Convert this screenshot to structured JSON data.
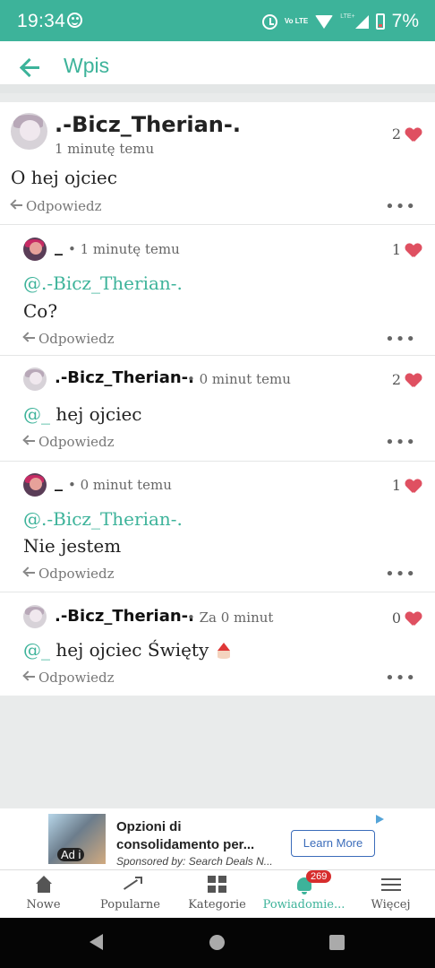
{
  "status": {
    "time": "19:34",
    "battery": "7%",
    "volte": "Vo LTE",
    "lte": "LTE+"
  },
  "app_bar": {
    "title": "Wpis"
  },
  "post": {
    "author": ".-Bicz_Therian-.",
    "time": "1 minutę temu",
    "likes": "2",
    "text": "O hej ojciec",
    "reply": "Odpowiedz"
  },
  "comments": [
    {
      "author": "_",
      "time": "• 1 minutę temu",
      "likes": "1",
      "mention": "@.-Bicz_Therian-.",
      "text": "Co?",
      "reply": "Odpowiedz"
    },
    {
      "author": ".-Bicz_Therian-.",
      "time": "• 0 minut temu",
      "likes": "2",
      "mention": "@_",
      "text": "hej ojciec",
      "reply": "Odpowiedz"
    },
    {
      "author": "_",
      "time": "• 0 minut temu",
      "likes": "1",
      "mention": "@.-Bicz_Therian-.",
      "text": "Nie jestem",
      "reply": "Odpowiedz"
    },
    {
      "author": ".-Bicz_Therian-.",
      "time": "• Za 0 minut",
      "likes": "0",
      "mention": "@_",
      "text": "hej ojciec Święty",
      "reply": "Odpowiedz"
    }
  ],
  "ad": {
    "badge": "Ad i",
    "title_line1": "Opzioni di",
    "title_line2": "consolidamento per...",
    "sponsor": "Sponsored by: Search Deals N...",
    "button": "Learn More"
  },
  "nav": {
    "items": [
      "Nowe",
      "Popularne",
      "Kategorie",
      "Powiadomie...",
      "Więcej"
    ],
    "badge": "269"
  }
}
